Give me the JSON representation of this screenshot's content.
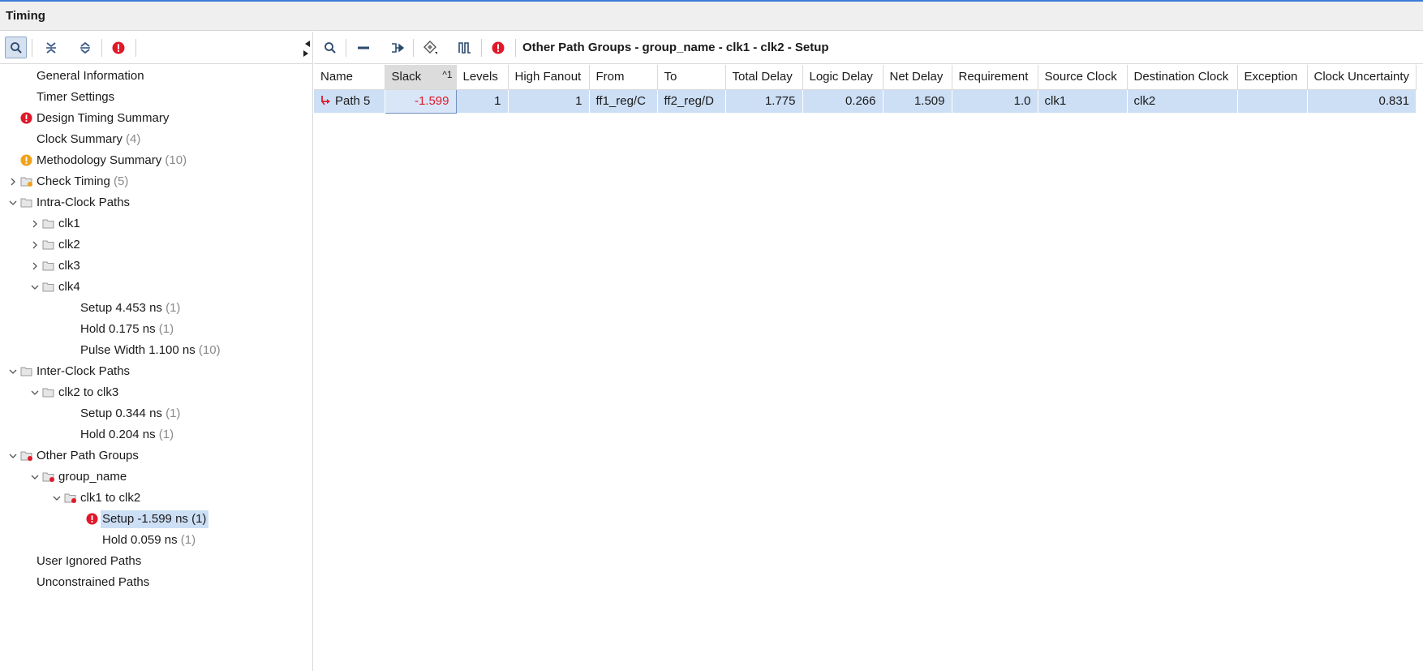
{
  "window": {
    "title": "Timing"
  },
  "left_toolbar": {
    "icons": [
      "search-icon",
      "collapse-all-icon",
      "expand-all-icon",
      "error-icon"
    ]
  },
  "tree": {
    "items": [
      {
        "label": "General Information",
        "count": ""
      },
      {
        "label": "Timer Settings",
        "count": ""
      },
      {
        "label": "Design Timing Summary",
        "count": "",
        "status": "error"
      },
      {
        "label": "Clock Summary",
        "count": "(4)"
      },
      {
        "label": "Methodology Summary",
        "count": "(10)",
        "status": "warning"
      },
      {
        "label": "Check Timing",
        "count": "(5)"
      },
      {
        "label": "Intra-Clock Paths",
        "count": ""
      },
      {
        "label": "clk1",
        "count": ""
      },
      {
        "label": "clk2",
        "count": ""
      },
      {
        "label": "clk3",
        "count": ""
      },
      {
        "label": "clk4",
        "count": ""
      },
      {
        "label": "Setup 4.453 ns",
        "count": "(1)"
      },
      {
        "label": "Hold 0.175 ns",
        "count": "(1)"
      },
      {
        "label": "Pulse Width 1.100 ns",
        "count": "(10)"
      },
      {
        "label": "Inter-Clock Paths",
        "count": ""
      },
      {
        "label": "clk2 to clk3",
        "count": ""
      },
      {
        "label": "Setup 0.344 ns",
        "count": "(1)"
      },
      {
        "label": "Hold 0.204 ns",
        "count": "(1)"
      },
      {
        "label": "Other Path Groups",
        "count": ""
      },
      {
        "label": "group_name",
        "count": ""
      },
      {
        "label": "clk1 to clk2",
        "count": ""
      },
      {
        "label": "Setup -1.599 ns (1)",
        "count": "",
        "status": "error",
        "selected": true
      },
      {
        "label": "Hold 0.059 ns",
        "count": "(1)"
      },
      {
        "label": "User Ignored Paths",
        "count": ""
      },
      {
        "label": "Unconstrained Paths",
        "count": ""
      }
    ]
  },
  "right_toolbar": {
    "icons": [
      "search-icon",
      "minus-icon",
      "schematic-icon",
      "highlight-icon",
      "waveform-icon",
      "error-icon"
    ],
    "title": "Other Path Groups - group_name - clk1 - clk2 - Setup"
  },
  "table": {
    "columns": [
      "Name",
      "Slack",
      "Levels",
      "High Fanout",
      "From",
      "To",
      "Total Delay",
      "Logic Delay",
      "Net Delay",
      "Requirement",
      "Source Clock",
      "Destination Clock",
      "Exception",
      "Clock Uncertainty"
    ],
    "sort_indicator": "^1",
    "rows": [
      {
        "name": "Path 5",
        "slack": "-1.599",
        "levels": "1",
        "high_fanout": "1",
        "from": "ff1_reg/C",
        "to": "ff2_reg/D",
        "total_delay": "1.775",
        "logic_delay": "0.266",
        "net_delay": "1.509",
        "requirement": "1.0",
        "source_clock": "clk1",
        "destination_clock": "clk2",
        "exception": "",
        "clock_uncertainty": "0.831"
      }
    ]
  },
  "colors": {
    "accent": "#3d7bd8",
    "selection": "#cddff5",
    "error": "#e0182a",
    "warning": "#f0a21c"
  }
}
